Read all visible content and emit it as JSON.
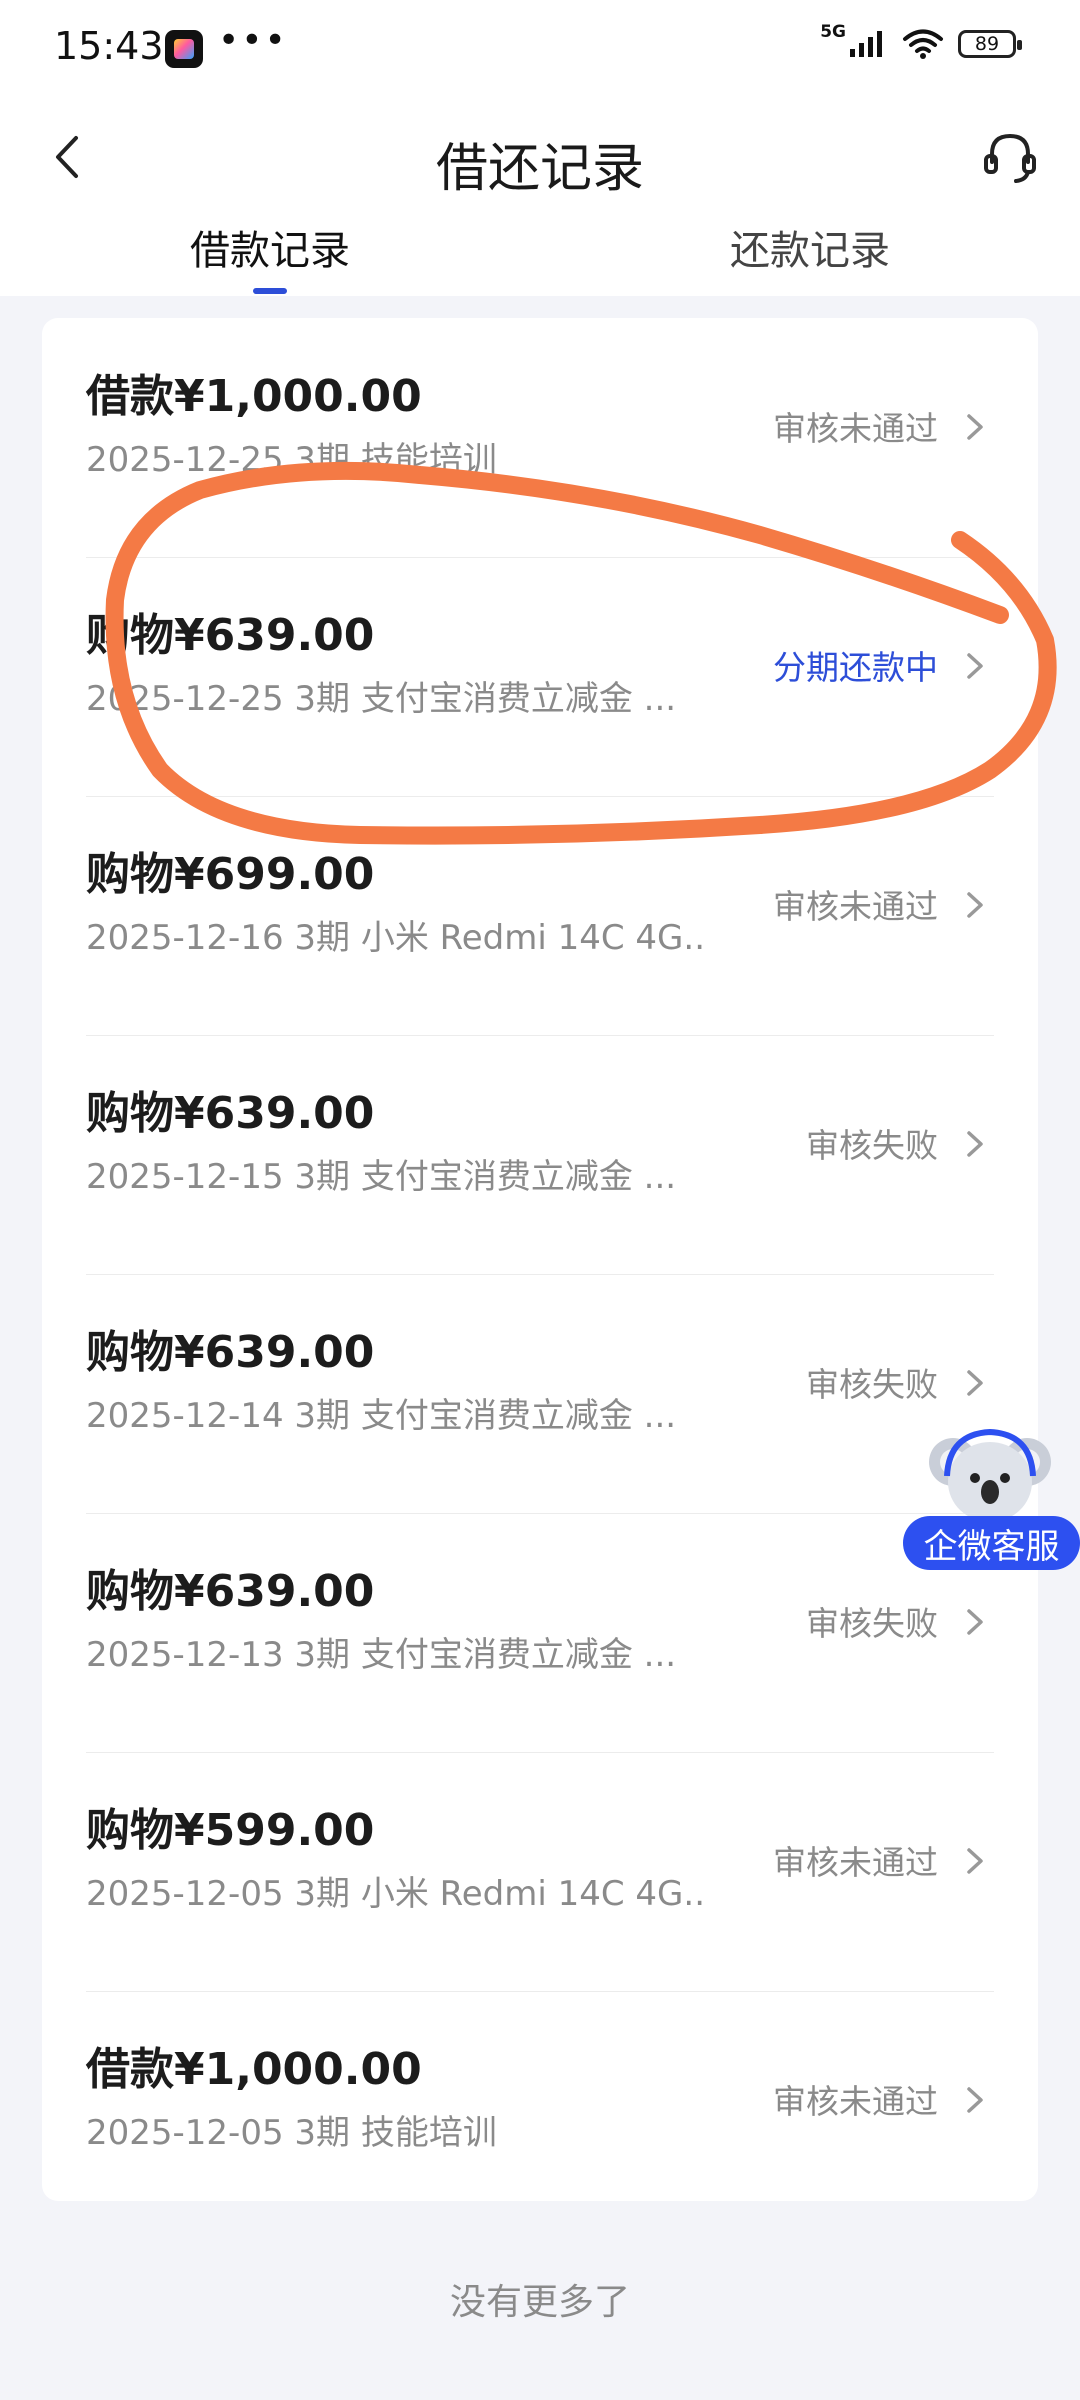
{
  "status_bar": {
    "time": "15:43",
    "dots": "•••",
    "network": "5G",
    "battery": "89"
  },
  "header": {
    "title": "借还记录",
    "back_icon": "chevron-left-icon",
    "service_icon": "headset-icon"
  },
  "tabs": [
    {
      "label": "借款记录",
      "active": true
    },
    {
      "label": "还款记录",
      "active": false
    }
  ],
  "records": [
    {
      "title": "借款¥1,000.00",
      "subtitle": "2025-12-25 3期  技能培训",
      "status": "审核未通过",
      "status_type": "gray"
    },
    {
      "title": "购物¥639.00",
      "subtitle": "2025-12-25 3期  支付宝消费立减金 ...",
      "status": "分期还款中",
      "status_type": "active"
    },
    {
      "title": "购物¥699.00",
      "subtitle": "2025-12-16 3期  小米 Redmi 14C 4G...",
      "status": "审核未通过",
      "status_type": "gray"
    },
    {
      "title": "购物¥639.00",
      "subtitle": "2025-12-15 3期  支付宝消费立减金 ...",
      "status": "审核失败",
      "status_type": "gray"
    },
    {
      "title": "购物¥639.00",
      "subtitle": "2025-12-14 3期  支付宝消费立减金 ...",
      "status": "审核失败",
      "status_type": "gray"
    },
    {
      "title": "购物¥639.00",
      "subtitle": "2025-12-13 3期  支付宝消费立减金 ...",
      "status": "审核失败",
      "status_type": "gray"
    },
    {
      "title": "购物¥599.00",
      "subtitle": "2025-12-05 3期  小米 Redmi 14C 4G...",
      "status": "审核未通过",
      "status_type": "gray"
    },
    {
      "title": "借款¥1,000.00",
      "subtitle": "2025-12-05 3期  技能培训",
      "status": "审核未通过",
      "status_type": "gray"
    }
  ],
  "end_text": "没有更多了",
  "floating_button": {
    "label": "企微客服",
    "icon": "koala-mascot-icon"
  },
  "colors": {
    "accent": "#2d4ed8",
    "highlight_stroke": "#f47a45",
    "background": "#f3f4f9"
  }
}
